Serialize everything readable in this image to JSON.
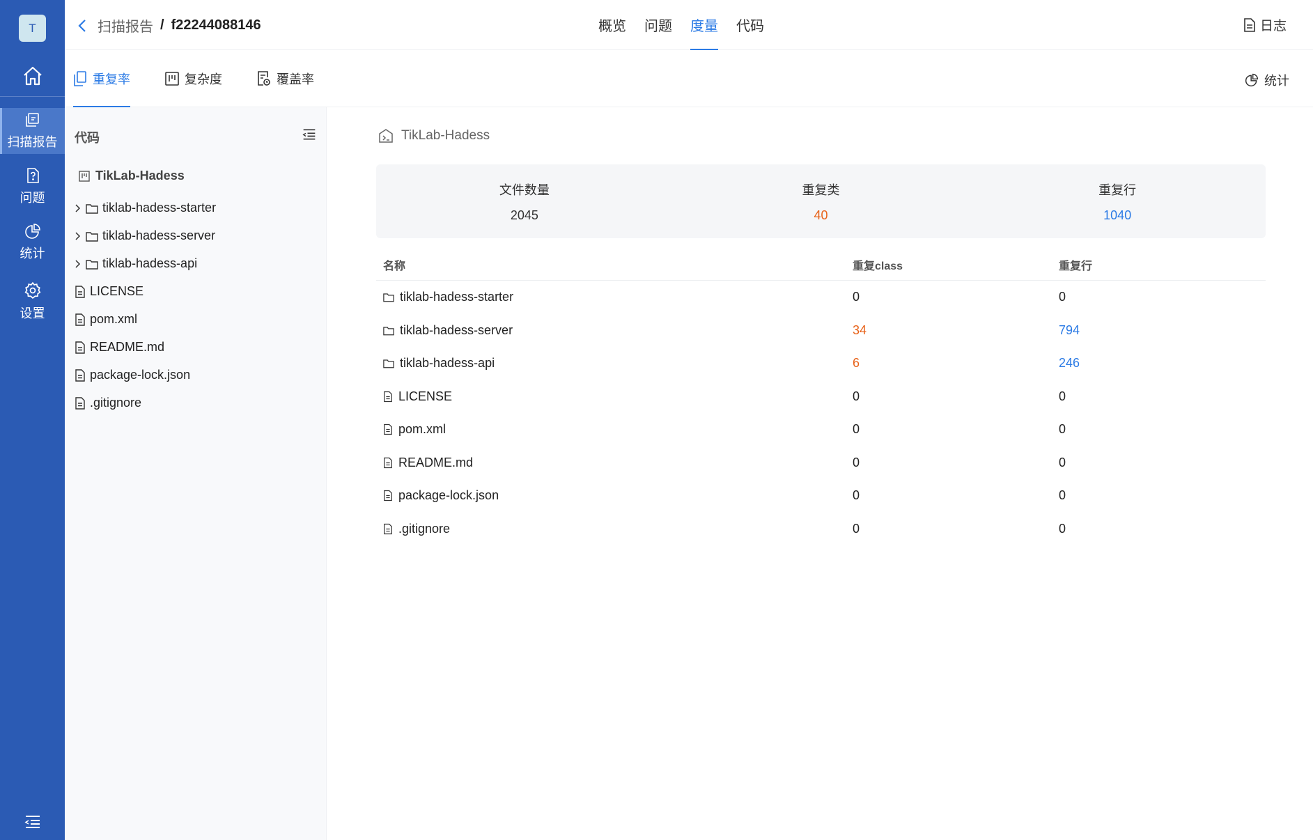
{
  "rail": {
    "avatar": "T",
    "items": [
      {
        "label": "扫描报告",
        "icon": "report-icon",
        "active": true
      },
      {
        "label": "问题",
        "icon": "issue-icon",
        "active": false
      },
      {
        "label": "统计",
        "icon": "pie-chart-icon",
        "active": false
      },
      {
        "label": "设置",
        "icon": "gear-icon",
        "active": false
      }
    ]
  },
  "header": {
    "breadcrumb_parent": "扫描报告",
    "separator": "/",
    "breadcrumb_current": "f22244088146",
    "tabs": [
      {
        "label": "概览",
        "active": false
      },
      {
        "label": "问题",
        "active": false
      },
      {
        "label": "度量",
        "active": true
      },
      {
        "label": "代码",
        "active": false
      }
    ],
    "log_label": "日志"
  },
  "subtabs": {
    "items": [
      {
        "label": "重复率",
        "icon": "duplicate-icon",
        "active": true
      },
      {
        "label": "复杂度",
        "icon": "complexity-icon",
        "active": false
      },
      {
        "label": "覆盖率",
        "icon": "coverage-icon",
        "active": false
      }
    ],
    "stats_label": "统计"
  },
  "tree": {
    "title": "代码",
    "root": "TikLab-Hadess",
    "items": [
      {
        "name": "tiklab-hadess-starter",
        "type": "folder"
      },
      {
        "name": "tiklab-hadess-server",
        "type": "folder"
      },
      {
        "name": "tiklab-hadess-api",
        "type": "folder"
      },
      {
        "name": "LICENSE",
        "type": "file"
      },
      {
        "name": "pom.xml",
        "type": "file"
      },
      {
        "name": "README.md",
        "type": "file"
      },
      {
        "name": "package-lock.json",
        "type": "file"
      },
      {
        "name": ".gitignore",
        "type": "file"
      }
    ]
  },
  "main": {
    "repo": "TikLab-Hadess",
    "summary": {
      "files_label": "文件数量",
      "files_value": "2045",
      "classes_label": "重复类",
      "classes_value": "40",
      "lines_label": "重复行",
      "lines_value": "1040"
    },
    "table": {
      "headers": {
        "name": "名称",
        "dup_class": "重复class",
        "dup_lines": "重复行"
      },
      "rows": [
        {
          "name": "tiklab-hadess-starter",
          "type": "folder",
          "dup_class": "0",
          "dup_lines": "0"
        },
        {
          "name": "tiklab-hadess-server",
          "type": "folder",
          "dup_class": "34",
          "dup_lines": "794"
        },
        {
          "name": "tiklab-hadess-api",
          "type": "folder",
          "dup_class": "6",
          "dup_lines": "246"
        },
        {
          "name": "LICENSE",
          "type": "file",
          "dup_class": "0",
          "dup_lines": "0"
        },
        {
          "name": "pom.xml",
          "type": "file",
          "dup_class": "0",
          "dup_lines": "0"
        },
        {
          "name": "README.md",
          "type": "file",
          "dup_class": "0",
          "dup_lines": "0"
        },
        {
          "name": "package-lock.json",
          "type": "file",
          "dup_class": "0",
          "dup_lines": "0"
        },
        {
          "name": ".gitignore",
          "type": "file",
          "dup_class": "0",
          "dup_lines": "0"
        }
      ]
    }
  },
  "colors": {
    "rail": "#2b5bb4",
    "accent": "#2c7be5",
    "warning": "#e8631a"
  }
}
